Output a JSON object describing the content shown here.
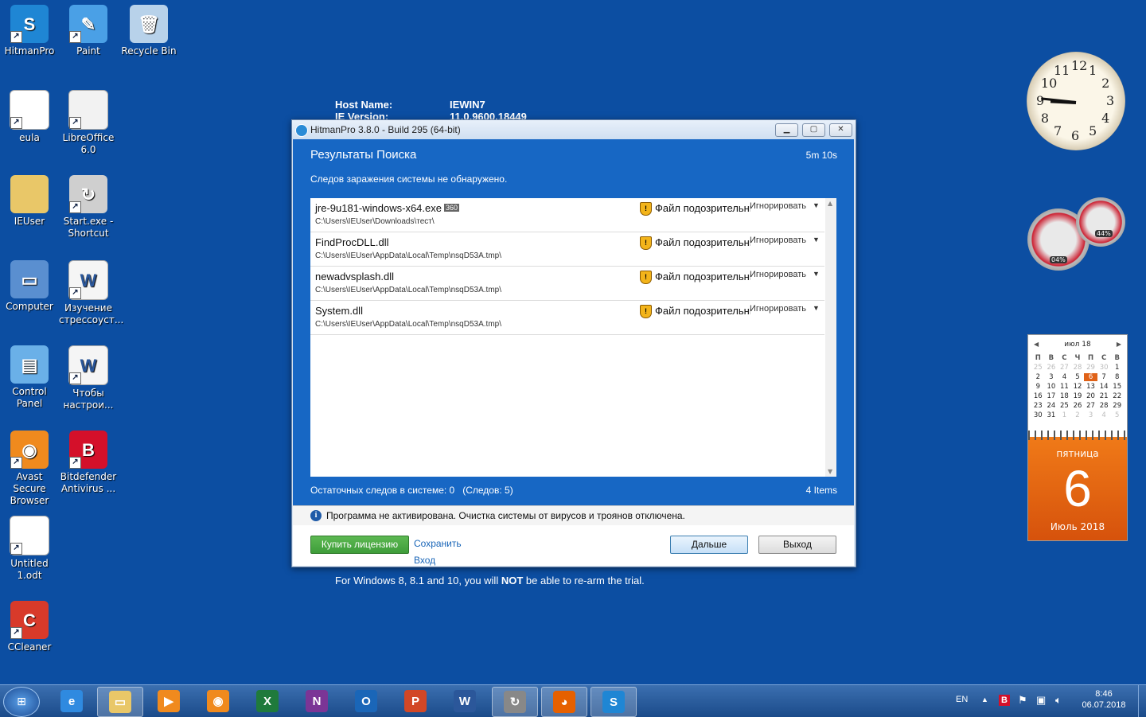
{
  "desktop_icons": [
    {
      "label": "HitmanPro",
      "icon": "hitmanpro-icon",
      "color": "#1f86d4",
      "glyph": "S"
    },
    {
      "label": "Paint",
      "icon": "paint-icon",
      "color": "#4aa0e6",
      "glyph": "✎"
    },
    {
      "label": "Recycle Bin",
      "icon": "recycle-bin-icon",
      "color": "#b8d2ea",
      "glyph": "🗑"
    },
    {
      "label": "eula",
      "icon": "text-file-icon",
      "color": "#ffffff",
      "glyph": ""
    },
    {
      "label": "LibreOffice 6.0",
      "icon": "libreoffice-icon",
      "color": "#f2f2f2",
      "glyph": ""
    },
    {
      "label": "IEUser",
      "icon": "user-folder-icon",
      "color": "#e9c768",
      "glyph": ""
    },
    {
      "label": "Start.exe - Shortcut",
      "icon": "start-shortcut-icon",
      "color": "#cfcfcf",
      "glyph": "↻"
    },
    {
      "label": "Computer",
      "icon": "computer-icon",
      "color": "#5a8fd0",
      "glyph": "▭"
    },
    {
      "label": "Изучение стрессоуст...",
      "icon": "word-document-icon",
      "color": "#f5f5f5",
      "glyph": "W"
    },
    {
      "label": "Control Panel",
      "icon": "control-panel-icon",
      "color": "#6ab0e8",
      "glyph": "▤"
    },
    {
      "label": "Чтобы настрои...",
      "icon": "word-document-icon",
      "color": "#f5f5f5",
      "glyph": "W"
    },
    {
      "label": "Avast Secure Browser",
      "icon": "avast-browser-icon",
      "color": "#f08a1e",
      "glyph": "◉"
    },
    {
      "label": "Bitdefender Antivirus ...",
      "icon": "bitdefender-icon",
      "color": "#d4102a",
      "glyph": "B"
    },
    {
      "label": "Untitled 1.odt",
      "icon": "odt-file-icon",
      "color": "#ffffff",
      "glyph": ""
    },
    {
      "label": "CCleaner",
      "icon": "ccleaner-icon",
      "color": "#d83a2a",
      "glyph": "C"
    }
  ],
  "background_text": {
    "host_label": "Host Name:",
    "host_value": "IEWIN7",
    "ie_label": "IE Version:",
    "ie_value": "11.0.9600.18449",
    "rearm_prefix": "For Windows 8, 8.1 and 10, you will ",
    "rearm_bold": "NOT",
    "rearm_suffix": " be able to re-arm the trial."
  },
  "window": {
    "title": "HitmanPro 3.8.0 - Build 295 (64-bit)",
    "heading": "Результаты Поиска",
    "elapsed": "5m 10s",
    "subtitle": "Следов заражения системы не обнаружено.",
    "results": [
      {
        "name": "jre-9u181-windows-x64.exe",
        "tag": "360",
        "path": "C:\\Users\\IEUser\\Downloads\\тест\\",
        "status": "Файл подозрительный",
        "action": "Игнорировать"
      },
      {
        "name": "FindProcDLL.dll",
        "tag": "",
        "path": "C:\\Users\\IEUser\\AppData\\Local\\Temp\\nsqD53A.tmp\\",
        "status": "Файл подозрительный",
        "action": "Игнорировать"
      },
      {
        "name": "newadvsplash.dll",
        "tag": "",
        "path": "C:\\Users\\IEUser\\AppData\\Local\\Temp\\nsqD53A.tmp\\",
        "status": "Файл подозрительный",
        "action": "Игнорировать"
      },
      {
        "name": "System.dll",
        "tag": "",
        "path": "C:\\Users\\IEUser\\AppData\\Local\\Temp\\nsqD53A.tmp\\",
        "status": "Файл подозрительный",
        "action": "Игнорировать"
      }
    ],
    "footer_left": "Остаточных следов в системе: 0   (Следов: 5)",
    "footer_right": "4 Items",
    "notice": "Программа не активирована. Очистка системы от вирусов и троянов отключена.",
    "buy_label": "Купить лицензию",
    "save_label": "Сохранить Вход",
    "next_label": "Дальше",
    "exit_label": "Выход"
  },
  "gadgets": {
    "clock_numbers": [
      "12",
      "1",
      "2",
      "3",
      "4",
      "5",
      "6",
      "7",
      "8",
      "9",
      "10",
      "11"
    ],
    "cpu_percent": "04%",
    "mem_percent": "44%",
    "calendar": {
      "month_label": "июл 18",
      "weekdays": [
        "П",
        "В",
        "С",
        "Ч",
        "П",
        "С",
        "В"
      ],
      "days": [
        "25",
        "26",
        "27",
        "28",
        "29",
        "30",
        "1",
        "2",
        "3",
        "4",
        "5",
        "6",
        "7",
        "8",
        "9",
        "10",
        "11",
        "12",
        "13",
        "14",
        "15",
        "16",
        "17",
        "18",
        "19",
        "20",
        "21",
        "22",
        "23",
        "24",
        "25",
        "26",
        "27",
        "28",
        "29",
        "30",
        "31",
        "1",
        "2",
        "3",
        "4",
        "5"
      ],
      "today_index": 11,
      "dim_before": 6,
      "dim_after_from": 37,
      "day_name": "пятница",
      "day_number": "6",
      "month_year": "Июль 2018"
    }
  },
  "taskbar": {
    "apps": [
      {
        "icon": "internet-explorer-icon",
        "glyph": "e",
        "color": "#2f8ae0",
        "active": false
      },
      {
        "icon": "file-explorer-icon",
        "glyph": "▭",
        "color": "#e9c768",
        "active": true
      },
      {
        "icon": "media-player-icon",
        "glyph": "▶",
        "color": "#f08a1e",
        "active": false
      },
      {
        "icon": "avast-browser-icon",
        "glyph": "◉",
        "color": "#f08a1e",
        "active": false
      },
      {
        "icon": "excel-icon",
        "glyph": "X",
        "color": "#1f7a3c",
        "active": false
      },
      {
        "icon": "onenote-icon",
        "glyph": "N",
        "color": "#7b3596",
        "active": false
      },
      {
        "icon": "outlook-icon",
        "glyph": "O",
        "color": "#1a66b8",
        "active": false
      },
      {
        "icon": "powerpoint-icon",
        "glyph": "P",
        "color": "#d24726",
        "active": false
      },
      {
        "icon": "word-icon",
        "glyph": "W",
        "color": "#2b579a",
        "active": false
      },
      {
        "icon": "start-shortcut-icon",
        "glyph": "↻",
        "color": "#888888",
        "active": true
      },
      {
        "icon": "firefox-icon",
        "glyph": "◕",
        "color": "#e66000",
        "active": true
      },
      {
        "icon": "hitmanpro-icon",
        "glyph": "S",
        "color": "#1f86d4",
        "active": true
      }
    ],
    "lang": "EN",
    "time": "8:46",
    "date": "06.07.2018"
  },
  "colors": {
    "desktop": "#0c4ea2",
    "window_blue": "#1767c4",
    "buy_green": "#3f9d3a",
    "link_blue": "#1a66b8",
    "calendar_orange": "#e06218"
  }
}
